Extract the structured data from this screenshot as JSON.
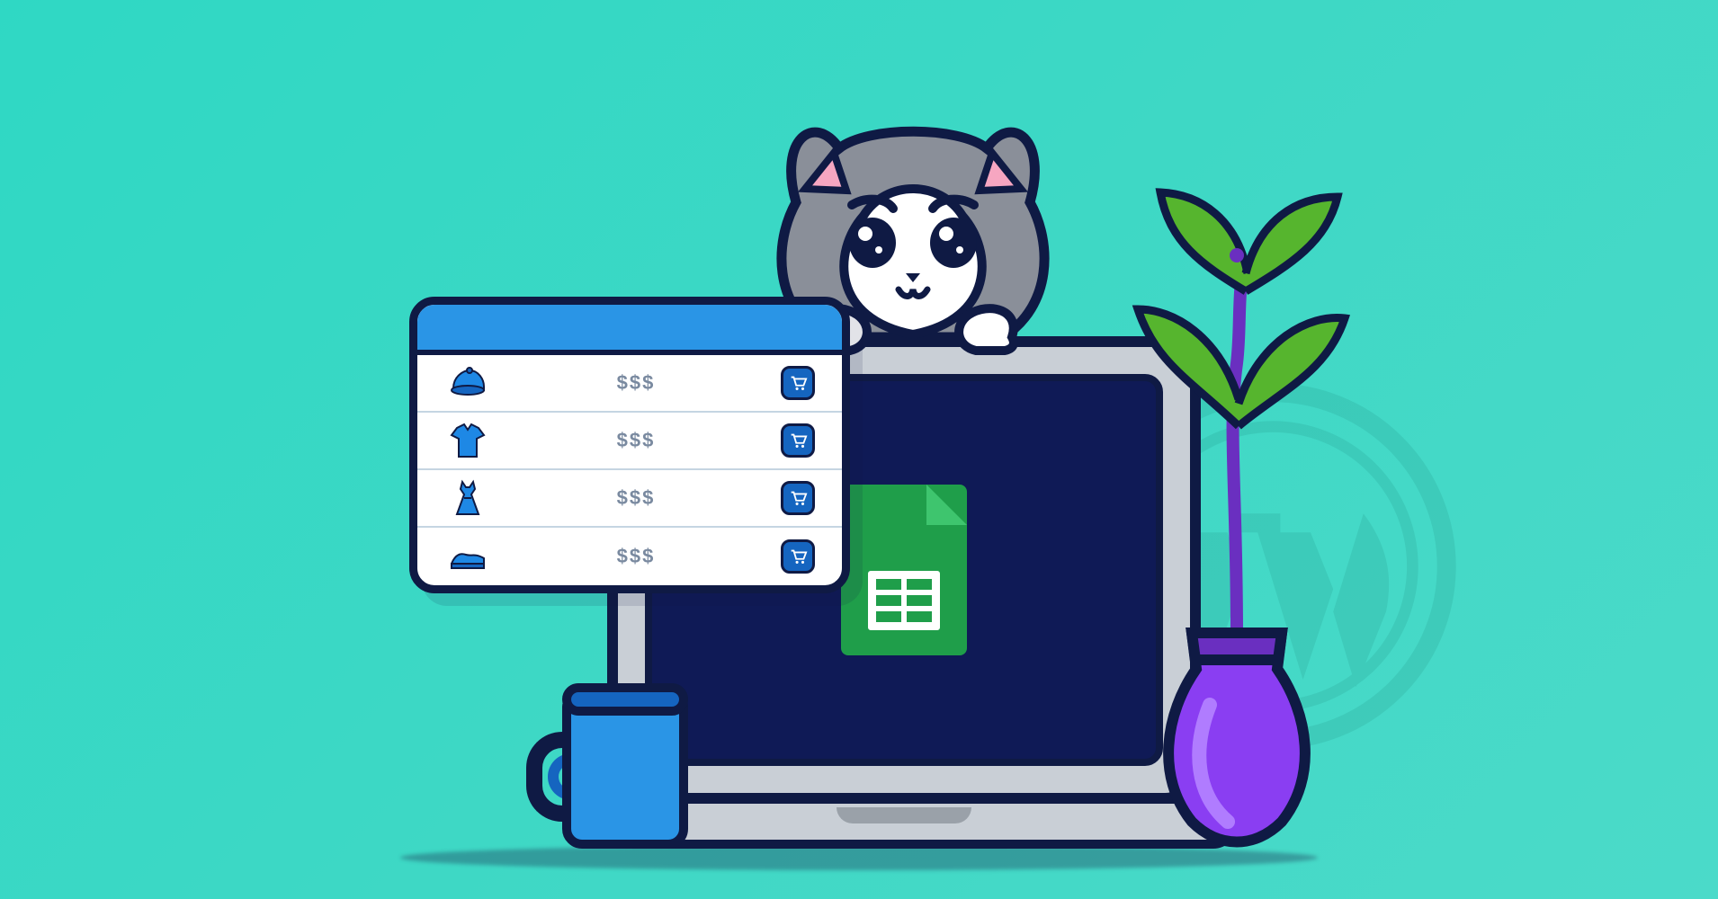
{
  "illustration": {
    "description": "Cartoon cat peeking over a laptop showing a Google Sheets file icon, with a floating product table panel, a blue mug, a purple vase with green plant, and a faint WordPress logo watermark on a teal gradient background.",
    "background_colors": [
      "#2fd8c4",
      "#4bdac9"
    ],
    "laptop_screen_color": "#0f1a56",
    "outline_color": "#0f1a44"
  },
  "panel": {
    "rows": [
      {
        "product": "cap",
        "price": "$$$"
      },
      {
        "product": "shirt",
        "price": "$$$"
      },
      {
        "product": "dress",
        "price": "$$$"
      },
      {
        "product": "shoe",
        "price": "$$$"
      }
    ]
  }
}
